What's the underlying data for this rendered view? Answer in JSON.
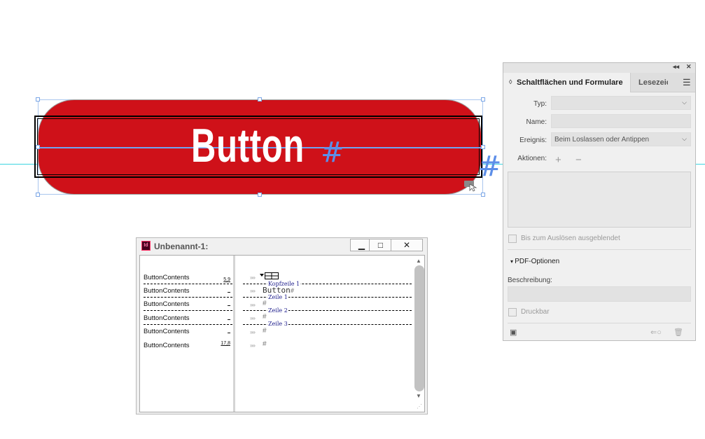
{
  "canvas": {
    "button_label": "Button",
    "hash_symbol": "#"
  },
  "story_editor": {
    "title": "Unbenannt-1:",
    "app_icon_text": "Id",
    "controls": {
      "minimize": "▁",
      "maximize": "□",
      "close": "✕"
    },
    "rows": [
      {
        "label": "ButtonContents",
        "depth": "5,9"
      },
      {
        "label": "ButtonContents",
        "depth": "_"
      },
      {
        "label": "ButtonContents",
        "depth": "_"
      },
      {
        "label": "ButtonContents",
        "depth": "_"
      },
      {
        "label": "ButtonContents",
        "depth": "_"
      },
      {
        "label": "ButtonContents",
        "depth": "17,8"
      }
    ],
    "chevron": "»»",
    "content_text": "Button",
    "hash": "#",
    "tags": {
      "header": "Kopfzeile 1",
      "row1": "Zeile 1",
      "row2": "Zeile 2",
      "row3": "Zeile 3"
    }
  },
  "panel": {
    "collapse_icon": "◂◂",
    "close_icon": "✕",
    "tab_active": "Schaltflächen und Formulare",
    "tab_other": "Lesezeichen",
    "menu_icon": "☰",
    "type_label": "Typ:",
    "type_value": "",
    "name_label": "Name:",
    "name_value": "",
    "event_label": "Ereignis:",
    "event_value": "Beim Loslassen oder Antippen",
    "actions_label": "Aktionen:",
    "add": "+",
    "remove": "−",
    "hidden_until_trigger": "Bis zum Auslösen ausgeblendet",
    "pdf_options": "PDF-Optionen",
    "description_label": "Beschreibung:",
    "printable": "Druckbar"
  }
}
